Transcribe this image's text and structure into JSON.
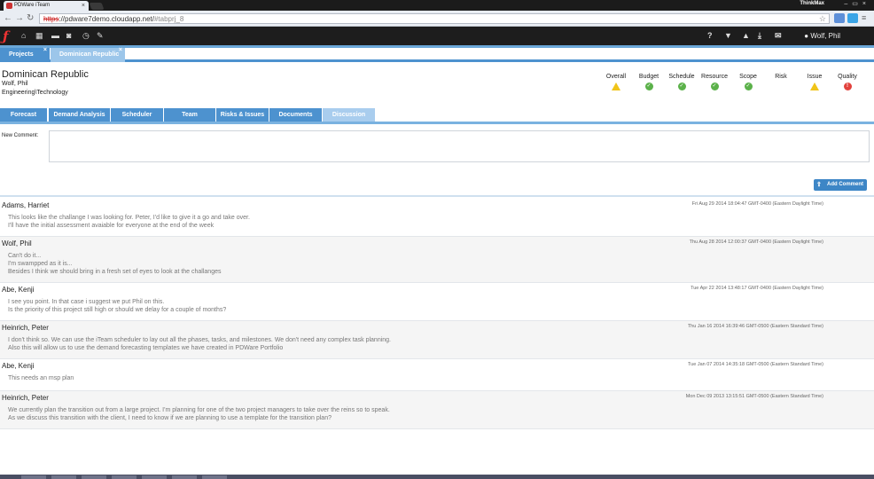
{
  "browser": {
    "tab_title": "PDWare iTeam",
    "url_scheme": "https",
    "url_rest": "://pdware7demo.cloudapp.net/",
    "url_fragment": "#tabprj_8",
    "profile_name": "ThinkMax"
  },
  "header": {
    "user_name": "Wolf, Phil"
  },
  "project_tabs": [
    {
      "label": "Projects"
    },
    {
      "label": "Dominican Republic"
    }
  ],
  "project": {
    "name": "Dominican Republic",
    "owner": "Wolf, Phil",
    "category": "Engineering\\Technology"
  },
  "status_indicators": [
    {
      "label": "Overall",
      "state": "warning"
    },
    {
      "label": "Budget",
      "state": "ok"
    },
    {
      "label": "Schedule",
      "state": "ok"
    },
    {
      "label": "Resource",
      "state": "ok"
    },
    {
      "label": "Scope",
      "state": "ok"
    },
    {
      "label": "Risk",
      "state": "none"
    },
    {
      "label": "Issue",
      "state": "warning"
    },
    {
      "label": "Quality",
      "state": "error"
    }
  ],
  "section_tabs": [
    {
      "label": "Forecast"
    },
    {
      "label": "Demand Analysis"
    },
    {
      "label": "Scheduler"
    },
    {
      "label": "Team"
    },
    {
      "label": "Risks & Issues"
    },
    {
      "label": "Documents"
    },
    {
      "label": "Discussion"
    }
  ],
  "new_comment": {
    "label": "New Comment:",
    "button_label": "Add Comment"
  },
  "comments": [
    {
      "author": "Adams, Harriet",
      "date": "Fri Aug 29 2014 18:04:47 GMT-0400 (Eastern Daylight Time)",
      "lines": [
        "This looks like the challange I was looking for. Peter, I'd like to give it a go and take over.",
        "I'll have the initial assessment avaiable for everyone at the end of the week"
      ]
    },
    {
      "author": "Wolf, Phil",
      "date": "Thu Aug 28 2014 12:00:37 GMT-0400 (Eastern Daylight Time)",
      "lines": [
        "Can't do it...",
        "I'm swampped as it is...",
        "Besides I think we should bring in a fresh set of eyes to look at the challanges"
      ]
    },
    {
      "author": "Abe, Kenji",
      "date": "Tue Apr 22 2014 13:48:17 GMT-0400 (Eastern Daylight Time)",
      "lines": [
        "I see you point. In that case i suggest we put Phil on this.",
        "Is the priority of this project still high or should we delay for a couple of months?"
      ]
    },
    {
      "author": "Heinrich, Peter",
      "date": "Thu Jan 16 2014 16:39:46 GMT-0500 (Eastern Standard Time)",
      "lines": [
        "I don't think so. We can use the iTeam scheduler to lay out all the phases, tasks, and milestones. We don't need any complex task planning.",
        "Also this will allow us to use the demand forecasting templates we have created in PDWare Portfolio"
      ]
    },
    {
      "author": "Abe, Kenji",
      "date": "Tue Jan 07 2014 14:35:18 GMT-0500 (Eastern Standard Time)",
      "lines": [
        "This needs an msp plan"
      ]
    },
    {
      "author": "Heinrich, Peter",
      "date": "Mon Dec 09 2013 13:15:51 GMT-0500 (Eastern Standard Time)",
      "lines": [
        "We currently plan the transition out from a large project. I'm planning for one of the two project managers to take over the reins so to speak.",
        "As we discuss this transition with the client, I need to know if we are planning to use a template for the transition plan?"
      ]
    }
  ]
}
